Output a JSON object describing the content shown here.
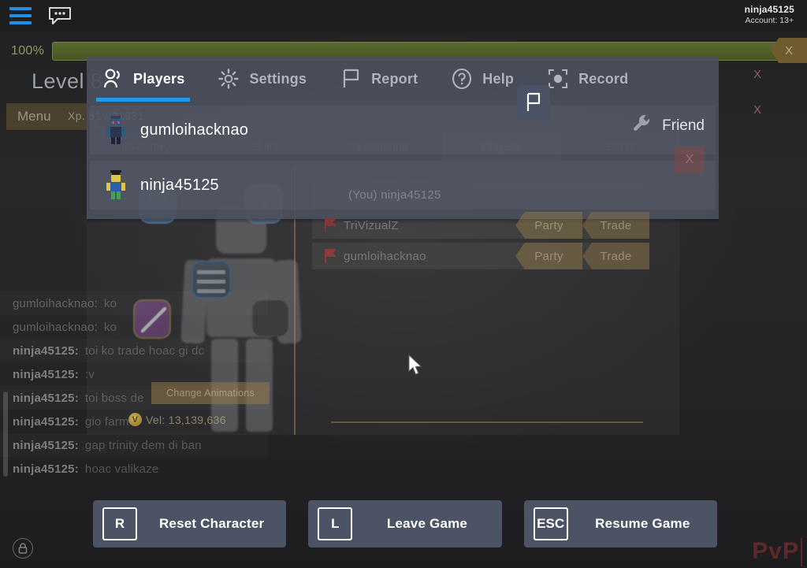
{
  "topbar": {
    "menu_icon": "hamburger-icon",
    "chat_icon": "chat-bubble-icon",
    "account_name": "ninja45125",
    "account_age": "Account: 13+"
  },
  "hud": {
    "xp_percent": "100%",
    "level_text": "Level 8",
    "menu_tab": "Menu",
    "xp_fraction": "Xp. 51 / 21931",
    "xp_chip_close": "X",
    "right_close_1": "X",
    "right_close_2": "X",
    "watermark": "PvP"
  },
  "modal": {
    "tabs": [
      {
        "label": "Players",
        "icon": "people-icon",
        "active": true
      },
      {
        "label": "Settings",
        "icon": "gear-icon",
        "active": false
      },
      {
        "label": "Report",
        "icon": "flag-icon",
        "active": false
      },
      {
        "label": "Help",
        "icon": "question-icon",
        "active": false
      },
      {
        "label": "Record",
        "icon": "record-icon",
        "active": false
      }
    ],
    "accent_color": "#1f9ae8",
    "rows": [
      {
        "name": "gumloihacknao"
      },
      {
        "name": "ninja45125"
      }
    ],
    "report_button_icon": "flag-icon",
    "wrench_icon": "wrench-icon",
    "friend_label": "Friend",
    "close_label": "X"
  },
  "game_tabs": [
    {
      "label": "Inventory",
      "selected": false
    },
    {
      "label": "Skills",
      "selected": false
    },
    {
      "label": "Locations",
      "selected": false
    },
    {
      "label": "Players",
      "selected": true
    },
    {
      "label": "Burst",
      "selected": false
    }
  ],
  "player_list": [
    {
      "name": "(You) ninja45125",
      "is_you": true,
      "flag": false,
      "actions": []
    },
    {
      "name": "TriVizualZ",
      "is_you": false,
      "flag": true,
      "actions": [
        "Party",
        "Trade"
      ]
    },
    {
      "name": "gumloihacknao",
      "is_you": false,
      "flag": true,
      "actions": [
        "Party",
        "Trade"
      ]
    }
  ],
  "character": {
    "change_animations": "Change Animations",
    "velocity_label": "Vel: 13,139,636",
    "coin_glyph": "V"
  },
  "chat": [
    {
      "name": "gumloihacknao:",
      "msg": "ko",
      "me": false
    },
    {
      "name": "gumloihacknao:",
      "msg": "ko",
      "me": false
    },
    {
      "name": "ninja45125:",
      "msg": "toi ko trade hoac gi dc",
      "me": true
    },
    {
      "name": "ninja45125:",
      "msg": ":v",
      "me": true
    },
    {
      "name": "ninja45125:",
      "msg": "toi boss de",
      "me": true
    },
    {
      "name": "ninja45125:",
      "msg": "gio farm",
      "me": true
    },
    {
      "name": "ninja45125:",
      "msg": "gap trinity dem di ban",
      "me": true
    },
    {
      "name": "ninja45125:",
      "msg": "hoac valikaze",
      "me": true
    }
  ],
  "bottom_buttons": [
    {
      "key": "R",
      "label": "Reset Character"
    },
    {
      "key": "L",
      "label": "Leave Game"
    },
    {
      "key": "ESC",
      "label": "Resume Game"
    }
  ]
}
